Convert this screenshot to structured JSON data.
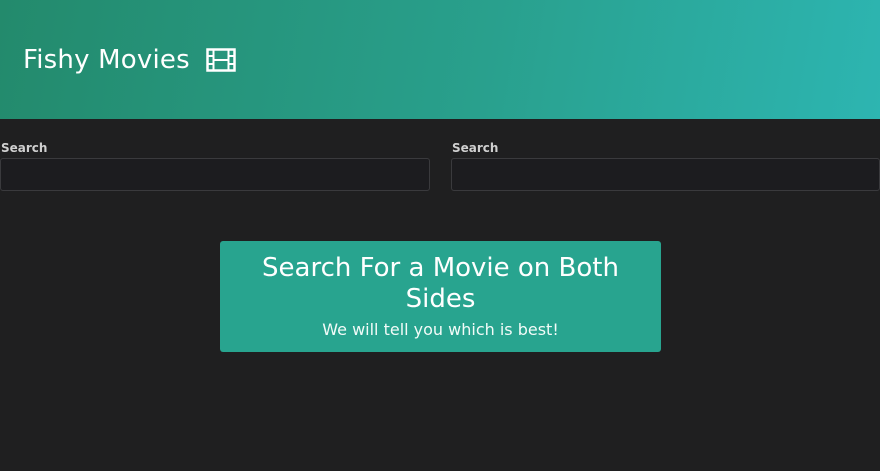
{
  "header": {
    "title": "Fishy Movies",
    "icon": "film-icon"
  },
  "search": [
    {
      "label": "Search",
      "value": "",
      "placeholder": ""
    },
    {
      "label": "Search",
      "value": "",
      "placeholder": ""
    }
  ],
  "callout": {
    "heading": "Search For a Movie on Both Sides",
    "subtext": "We will tell you which is best!"
  },
  "colors": {
    "header_gradient_start": "#238a6c",
    "header_gradient_end": "#2db5b1",
    "background": "#1f1f20",
    "callout_bg": "#28a48f",
    "text": "#ffffff"
  }
}
